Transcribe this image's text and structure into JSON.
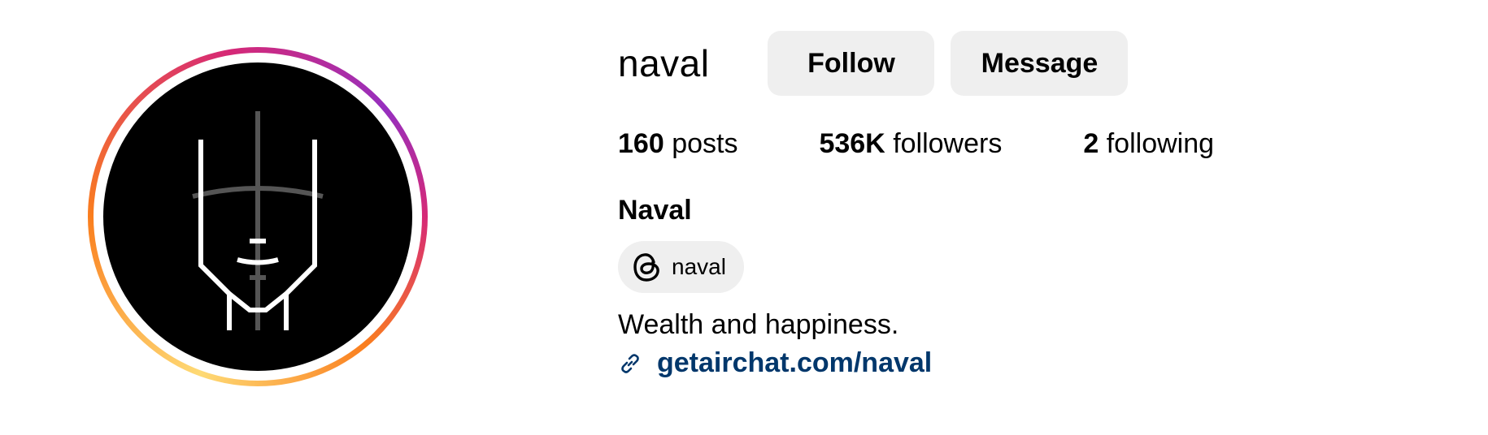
{
  "profile": {
    "username": "naval",
    "full_name": "Naval",
    "bio": "Wealth and happiness.",
    "link": "getairchat.com/naval",
    "threads_handle": "naval"
  },
  "buttons": {
    "follow": "Follow",
    "message": "Message"
  },
  "stats": {
    "posts": {
      "count": "160",
      "label": "posts"
    },
    "followers": {
      "count": "536K",
      "label": "followers"
    },
    "following": {
      "count": "2",
      "label": "following"
    }
  },
  "icons": {
    "threads": "threads-icon",
    "link": "link-icon"
  },
  "colors": {
    "button_bg": "#efefef",
    "link": "#00376b",
    "ring_start": "#feda75",
    "ring_mid": "#fa7e1e",
    "ring_end": "#d62976"
  }
}
